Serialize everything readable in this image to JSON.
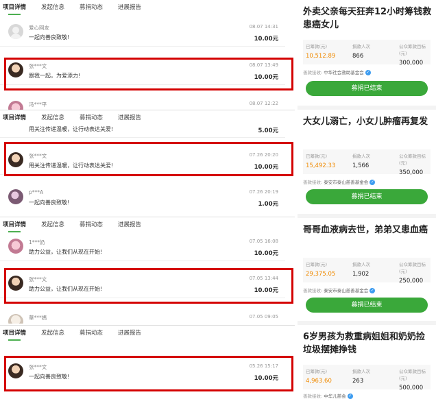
{
  "tabs": [
    "项目详情",
    "发起信息",
    "募捐动态",
    "进展报告"
  ],
  "panel1": {
    "rows": [
      {
        "name": "爱心网友",
        "date": "08.07 14:31",
        "msg": "一起向善良致敬!",
        "amount": "10.00元"
      },
      {
        "name": "张***文",
        "date": "08.07 13:49",
        "msg": "跟我一起，为爱添力!",
        "amount": "10.00元"
      },
      {
        "name": "冯***平",
        "date": "08.07 12:22",
        "msg": "",
        "amount": ""
      }
    ]
  },
  "panel2": {
    "rows": [
      {
        "name": "",
        "date": "",
        "msg": "用关注传递温暖，让行动表达关爱!",
        "amount": "5.00元"
      },
      {
        "name": "张***文",
        "date": "07.26 20:20",
        "msg": "用关注传递温暖，让行动表达关爱!",
        "amount": "10.00元"
      },
      {
        "name": "p***A",
        "date": "07.26 20:19",
        "msg": "一起向善良致敬!",
        "amount": "1.00元"
      }
    ]
  },
  "panel3": {
    "rows": [
      {
        "name": "1***奶",
        "date": "07.05 16:08",
        "msg": "助力公益，让我们从现在开始!",
        "amount": "10.00元"
      },
      {
        "name": "张***文",
        "date": "07.05 13:44",
        "msg": "助力公益，让我们从现在开始!",
        "amount": "10.00元"
      },
      {
        "name": "華***媽",
        "date": "07.05 09:05",
        "msg": "",
        "amount": ""
      }
    ]
  },
  "panel4": {
    "rows": [
      {
        "name": "张***文",
        "date": "05.26 15:17",
        "msg": "一起向善良致敬!",
        "amount": "10.00元"
      }
    ]
  },
  "stat_labels": {
    "raised": "已筹款(元)",
    "donors": "捐款人次",
    "goal": "公众筹款目标(元)",
    "recipient": "善款接收:"
  },
  "cards": [
    {
      "title": "外卖父亲每天狂奔12小时筹钱救患癌女儿",
      "raised": "10,512.89",
      "donors": "866",
      "goal": "300,000",
      "org": "中华社会救助基金会",
      "button": "募捐已结束"
    },
    {
      "title": "大女儿溺亡，小女儿肿瘤再复发",
      "raised": "15,492.33",
      "donors": "1,566",
      "goal": "350,000",
      "org": "泰安市泰山慈善基金会",
      "button": "募捐已结束"
    },
    {
      "title": "哥哥血液病去世，弟弟又患血癌",
      "raised": "29,375.05",
      "donors": "1,902",
      "goal": "250,000",
      "org": "泰安市泰山慈善基金会",
      "button": "募捐已结束"
    },
    {
      "title": "6岁男孩为救重病姐姐和奶奶捡垃圾摆摊挣钱",
      "raised": "4,963.60",
      "donors": "263",
      "goal": "500,000",
      "org": "中华儿慈会",
      "button": ""
    }
  ],
  "colors": {
    "accent": "#3aa83a",
    "highlight": "#d40000",
    "raised": "#f08a00"
  }
}
